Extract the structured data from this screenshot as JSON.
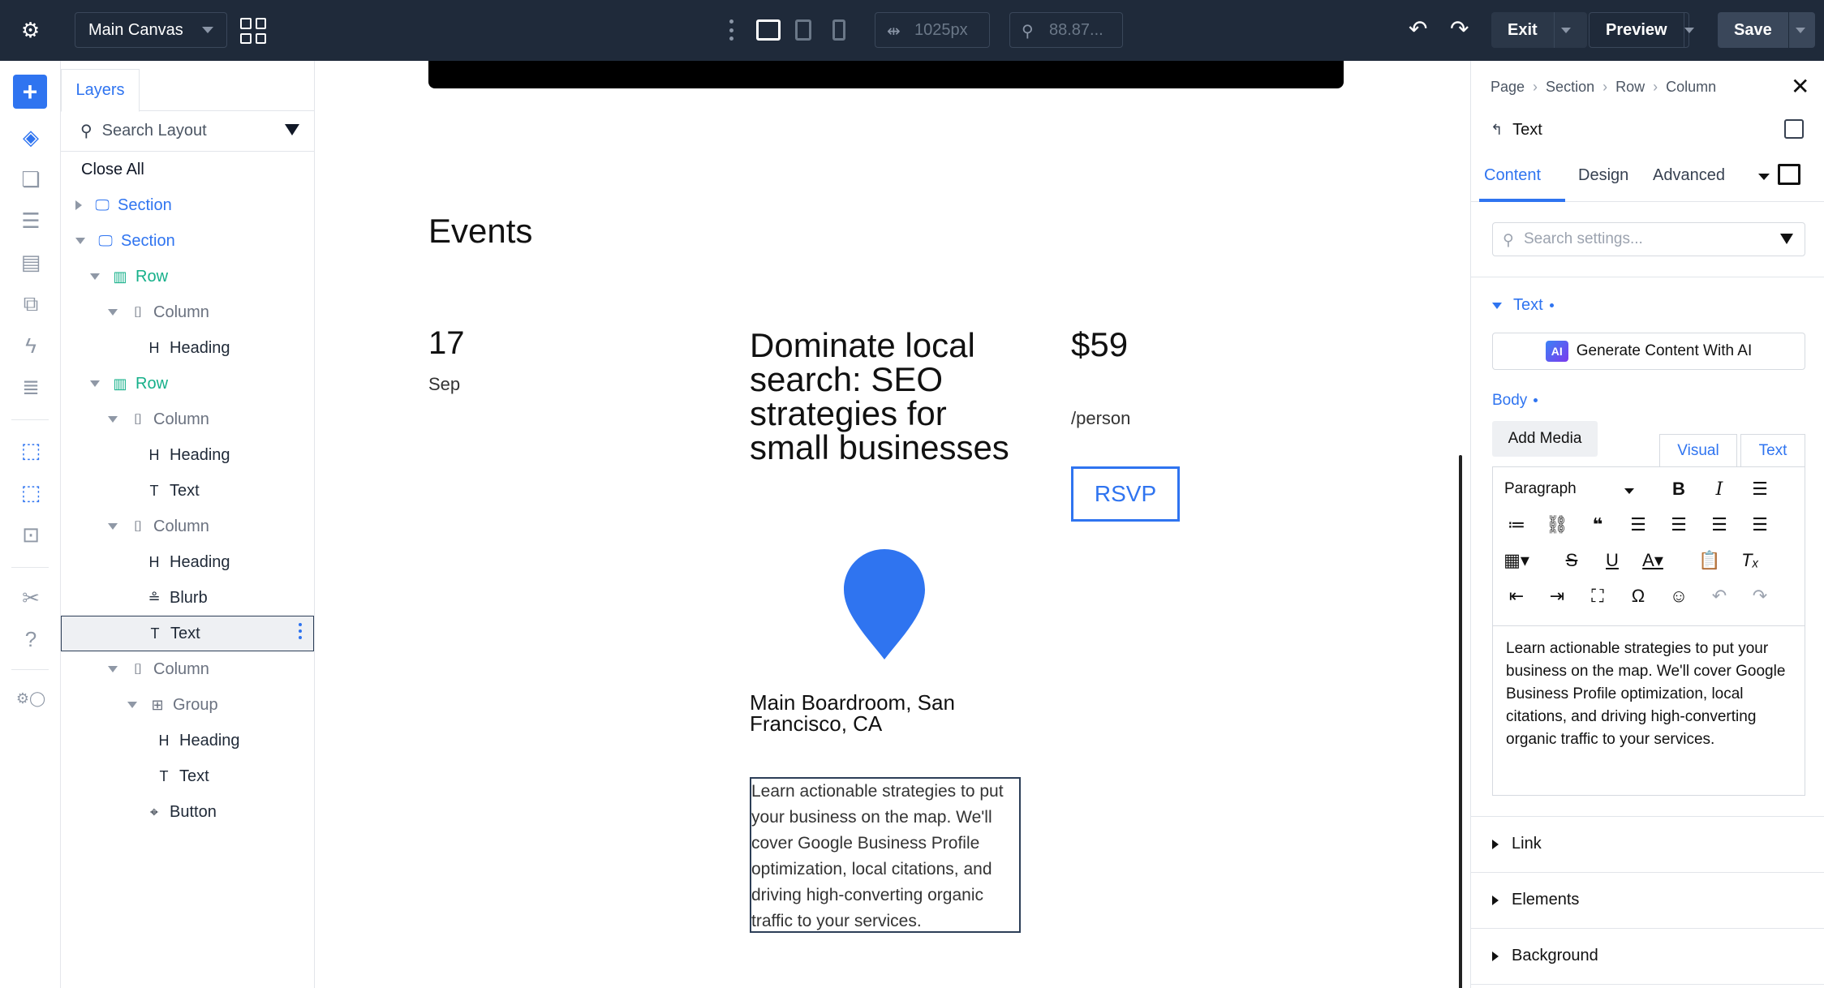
{
  "topbar": {
    "canvas_name": "Main Canvas",
    "width_value": "1025px",
    "zoom_value": "88.87...",
    "exit_label": "Exit",
    "preview_label": "Preview",
    "save_label": "Save"
  },
  "layers": {
    "tab_label": "Layers",
    "search_placeholder": "Search Layout",
    "close_all": "Close All",
    "tree": [
      {
        "label": "Section",
        "kind": "section",
        "indent": 0,
        "arrow": "right"
      },
      {
        "label": "Section",
        "kind": "section",
        "indent": 0,
        "arrow": "down"
      },
      {
        "label": "Row",
        "kind": "row",
        "indent": 1,
        "arrow": "down"
      },
      {
        "label": "Column",
        "kind": "column",
        "indent": 2,
        "arrow": "down"
      },
      {
        "label": "Heading",
        "kind": "heading",
        "indent": 3,
        "arrow": ""
      },
      {
        "label": "Row",
        "kind": "row",
        "indent": 1,
        "arrow": "down"
      },
      {
        "label": "Column",
        "kind": "column",
        "indent": 2,
        "arrow": "down"
      },
      {
        "label": "Heading",
        "kind": "heading",
        "indent": 3,
        "arrow": ""
      },
      {
        "label": "Text",
        "kind": "text",
        "indent": 3,
        "arrow": ""
      },
      {
        "label": "Column",
        "kind": "column",
        "indent": 2,
        "arrow": "down"
      },
      {
        "label": "Heading",
        "kind": "heading",
        "indent": 3,
        "arrow": ""
      },
      {
        "label": "Blurb",
        "kind": "blurb",
        "indent": 3,
        "arrow": ""
      },
      {
        "label": "Text",
        "kind": "text",
        "indent": 3,
        "arrow": "",
        "selected": true
      },
      {
        "label": "Column",
        "kind": "column",
        "indent": 2,
        "arrow": "down"
      },
      {
        "label": "Group",
        "kind": "group",
        "indent": 3,
        "arrow": "down"
      },
      {
        "label": "Heading",
        "kind": "heading",
        "indent": 4,
        "arrow": ""
      },
      {
        "label": "Text",
        "kind": "text",
        "indent": 4,
        "arrow": ""
      },
      {
        "label": "Button",
        "kind": "button",
        "indent": 3,
        "arrow": ""
      }
    ]
  },
  "canvas": {
    "section_title": "Events",
    "event": {
      "day": "17",
      "month": "Sep",
      "title": "Dominate local search: SEO strategies for small businesses",
      "price": "$59",
      "price_unit": "/person",
      "rsvp_label": "RSVP",
      "venue": "Main Boardroom, San Francisco, CA",
      "description": "Learn actionable strategies to put your business on the map. We'll cover Google Business Profile optimization, local citations, and driving high-converting organic traffic to your services."
    },
    "accent_color": "#2f74f0"
  },
  "settings": {
    "breadcrumb": [
      "Page",
      "Section",
      "Row",
      "Column"
    ],
    "module_title": "Text",
    "tabs": [
      "Content",
      "Design",
      "Advanced"
    ],
    "active_tab": "Content",
    "search_placeholder": "Search settings...",
    "text_group_label": "Text",
    "ai_button_label": "Generate Content With AI",
    "ai_badge": "AI",
    "body_label": "Body",
    "add_media_label": "Add Media",
    "editor_tabs": [
      "Visual",
      "Text"
    ],
    "paragraph_select": "Paragraph",
    "editor_content": "Learn actionable strategies to put your business on the map. We'll cover Google Business Profile optimization, local citations, and driving high-converting organic traffic to your services.",
    "collapsed_groups": [
      "Link",
      "Elements",
      "Background"
    ]
  }
}
